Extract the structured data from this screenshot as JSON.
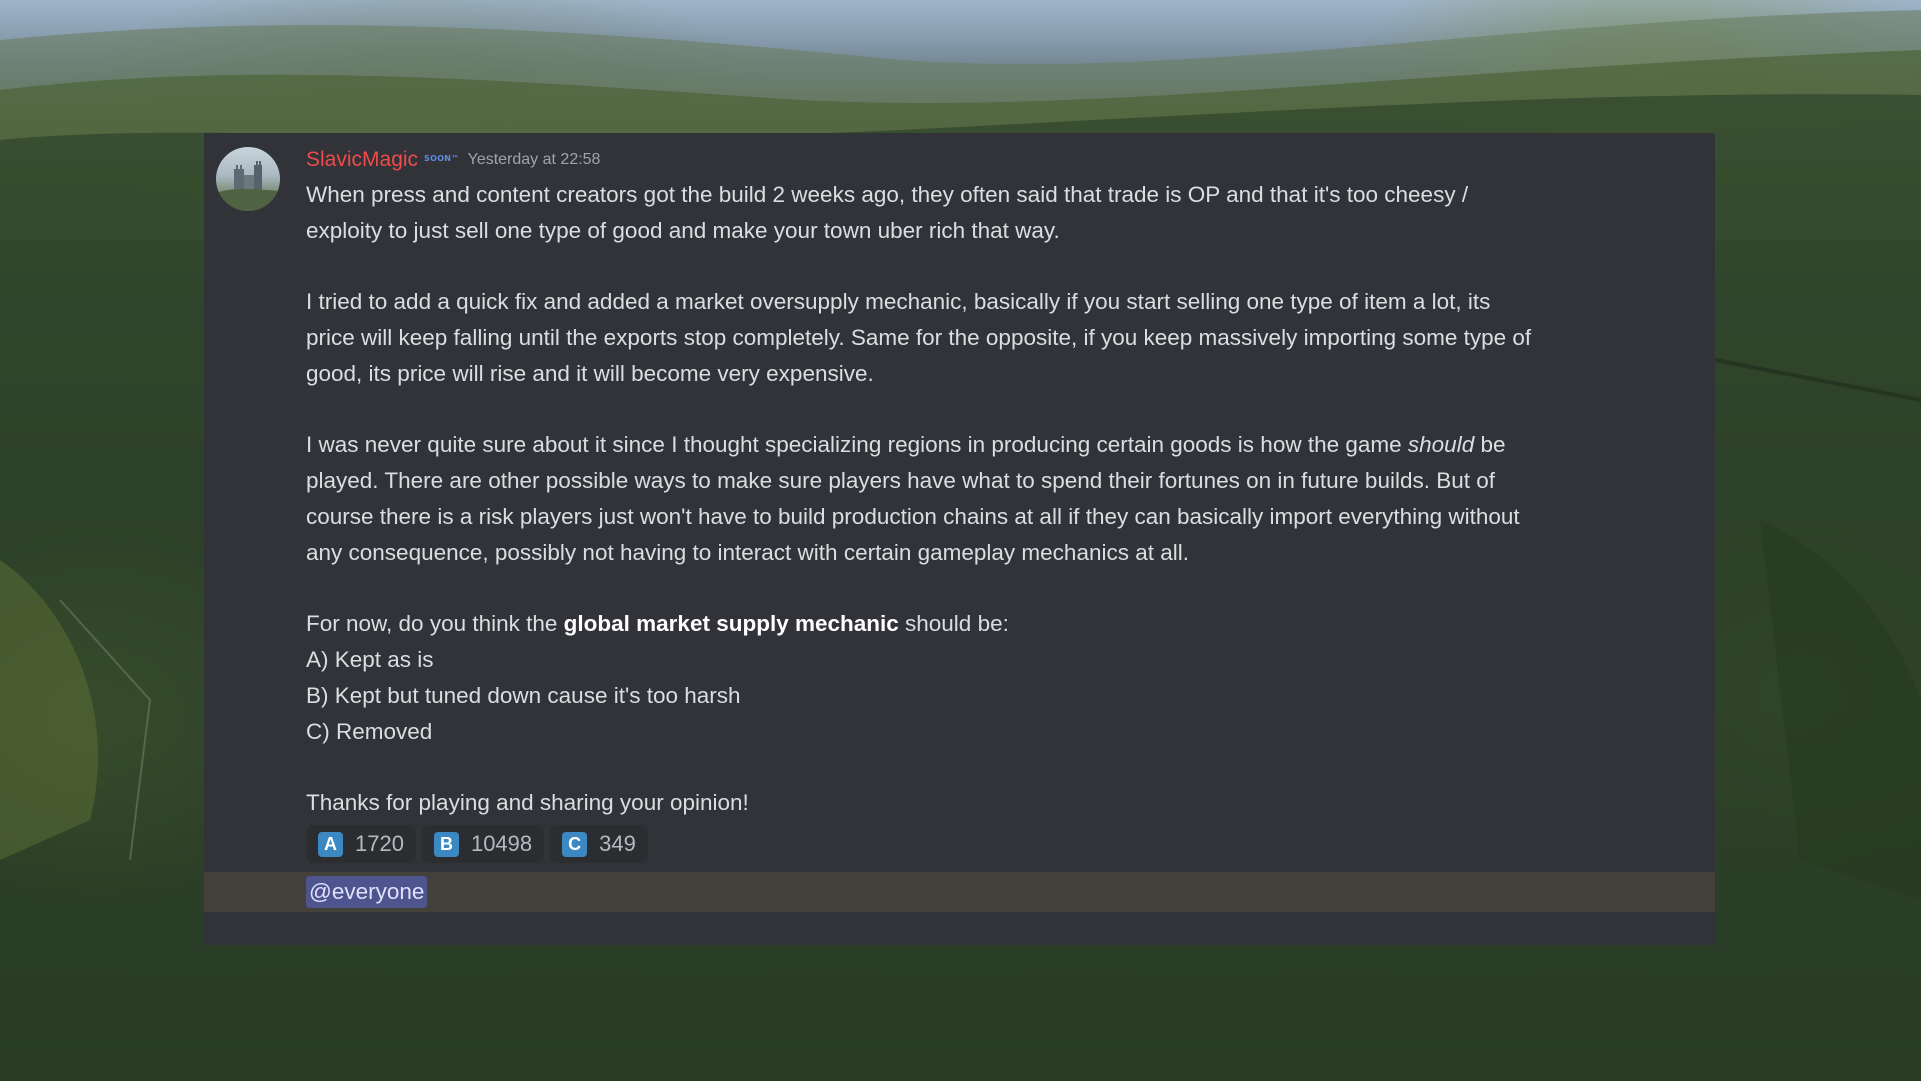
{
  "message": {
    "username": "SlavicMagic",
    "tag": "SOON™",
    "timestamp": "Yesterday at 22:58",
    "paragraph1_line1": "When press and content creators got the build 2 weeks ago, they often said that trade is OP and that it's too cheesy /",
    "paragraph1_line2": "exploity to just sell one type of good and make your town uber rich that way.",
    "paragraph2_line1": "I tried to add a quick fix and added a market oversupply mechanic, basically if you start selling one type of item a lot, its",
    "paragraph2_line2": "price will keep falling until the exports stop completely. Same for the opposite, if you keep massively importing some type of",
    "paragraph2_line3": "good, its price will rise and it will become very expensive.",
    "paragraph3_line1_pre": "I was never quite sure about it since I thought specializing regions in producing certain goods is how the game ",
    "paragraph3_line1_em": "should",
    "paragraph3_line1_post": " be",
    "paragraph3_line2": "played. There are other possible ways to make sure players have what to spend their fortunes on in future builds. But of",
    "paragraph3_line3": "course there is a risk players just won't have to build production chains at all if they can basically import everything without",
    "paragraph3_line4": "any consequence, possibly not having to interact with certain gameplay mechanics at all.",
    "question_pre": "For now, do you think the ",
    "question_bold": "global market supply mechanic",
    "question_post": " should be:",
    "option_a": "A) Kept as is",
    "option_b": "B) Kept but tuned down cause it's too harsh",
    "option_c": "C) Removed",
    "closing": "Thanks for playing and sharing your opinion!",
    "mention": "@everyone"
  },
  "reactions": [
    {
      "emoji": "A",
      "emoji_icon": "regional-indicator-a",
      "count": "1720"
    },
    {
      "emoji": "B",
      "emoji_icon": "regional-indicator-b",
      "count": "10498"
    },
    {
      "emoji": "C",
      "emoji_icon": "regional-indicator-c",
      "count": "349"
    }
  ],
  "colors": {
    "panel_bg": "#313338",
    "username": "#f04b4b",
    "text": "#dbdee1",
    "mention_bg": "#4e548e",
    "mention_row": "#44403a",
    "emoji_bg": "#3b88c3"
  }
}
